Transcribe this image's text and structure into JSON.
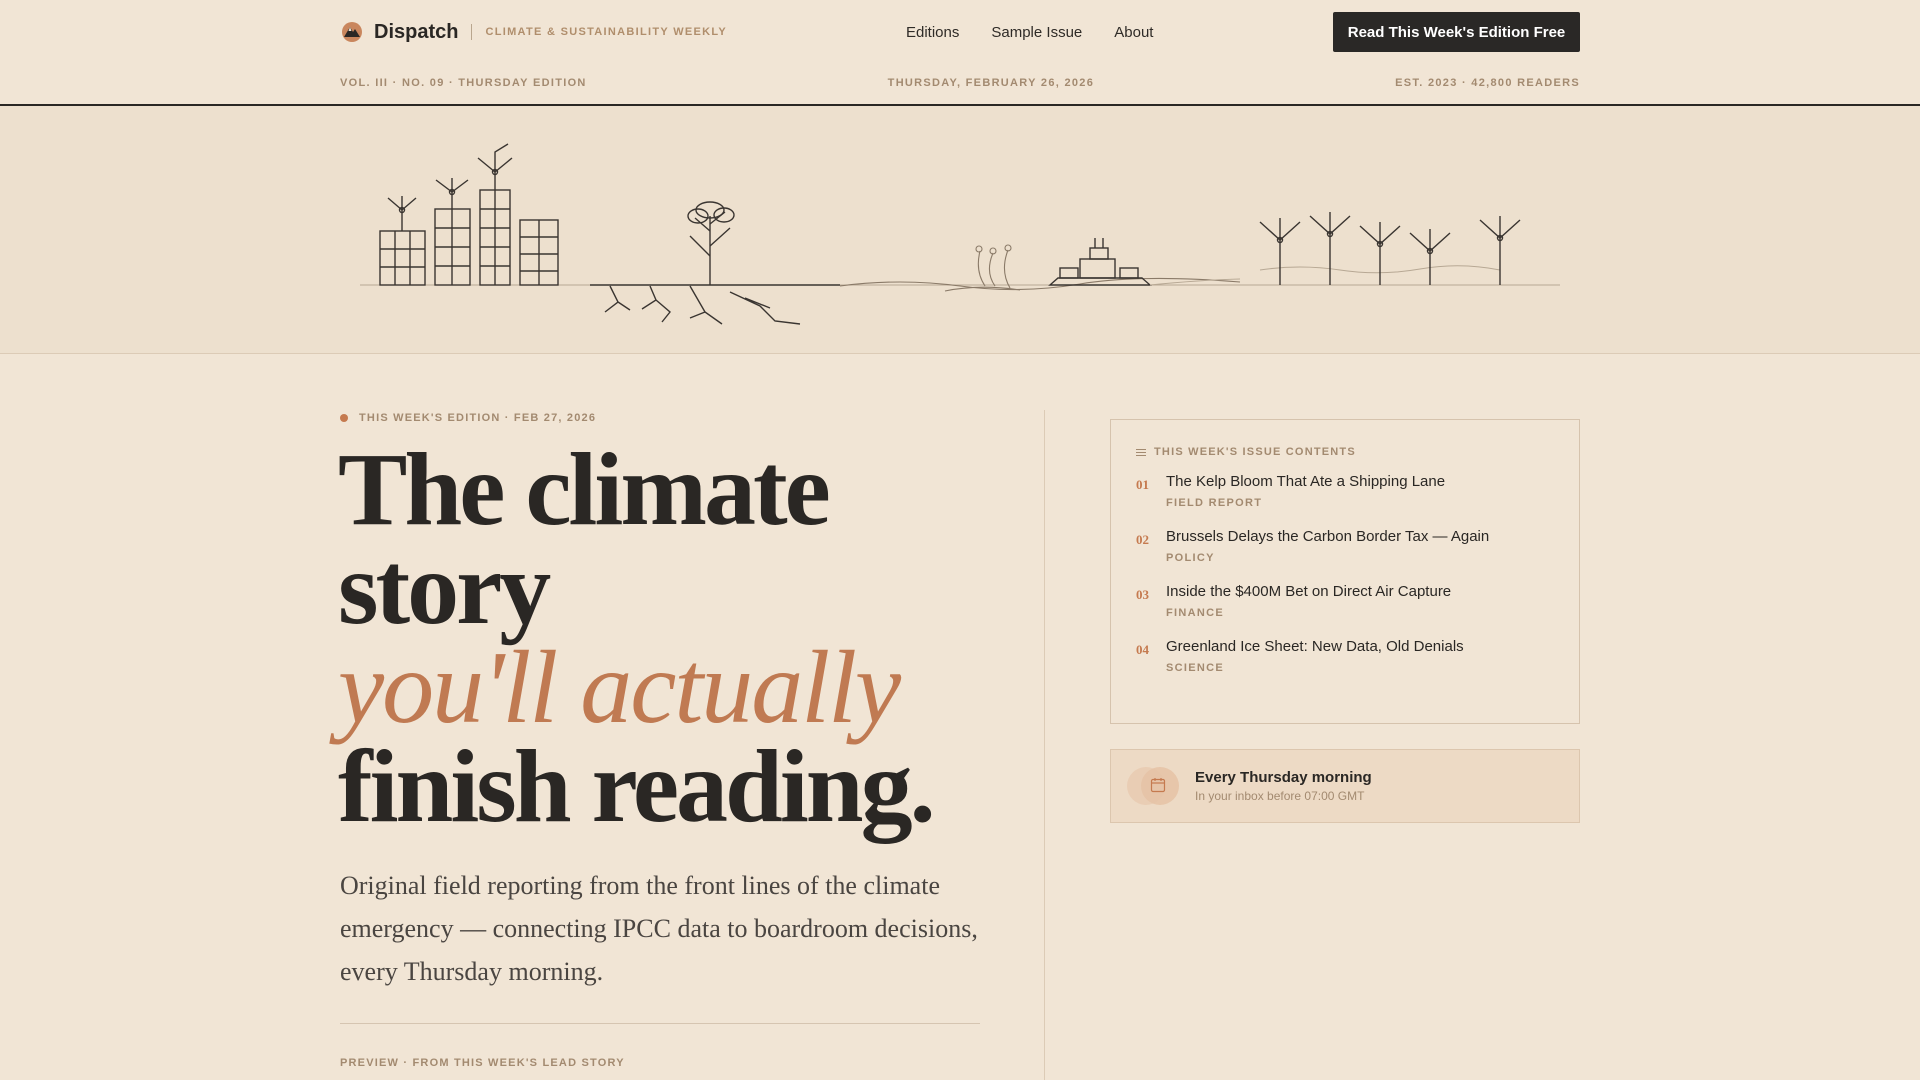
{
  "brand": {
    "name": "Dispatch",
    "tagline": "CLIMATE & SUSTAINABILITY WEEKLY"
  },
  "nav": {
    "links": [
      "Editions",
      "Sample Issue",
      "About"
    ],
    "cta": "Read This Week's Edition Free"
  },
  "masthead": {
    "left": "VOL. III · NO. 09 · THURSDAY EDITION",
    "center": "THURSDAY, FEBRUARY 26, 2026",
    "right": "EST. 2023 · 42,800 READERS"
  },
  "hero": {
    "eyebrow": "THIS WEEK'S EDITION · FEB 27, 2026",
    "headline_line1": "The climate",
    "headline_line2": "story",
    "headline_accent": "you'll actually",
    "headline_line4": "finish reading.",
    "lede": "Original field reporting from the front lines of the climate emergency — connecting IPCC data to boardroom decisions, every Thursday morning.",
    "preview_label": "PREVIEW · FROM THIS WEEK'S LEAD STORY"
  },
  "contents": {
    "title": "THIS WEEK'S ISSUE CONTENTS",
    "items": [
      {
        "num": "01",
        "title": "The Kelp Bloom That Ate a Shipping Lane",
        "category": "FIELD REPORT"
      },
      {
        "num": "02",
        "title": "Brussels Delays the Carbon Border Tax — Again",
        "category": "POLICY"
      },
      {
        "num": "03",
        "title": "Inside the $400M Bet on Direct Air Capture",
        "category": "FINANCE"
      },
      {
        "num": "04",
        "title": "Greenland Ice Sheet: New Data, Old Denials",
        "category": "SCIENCE"
      }
    ]
  },
  "schedule": {
    "title": "Every Thursday morning",
    "subtitle": "In your inbox before 07:00 GMT",
    "icon": "calendar-icon"
  },
  "colors": {
    "background": "#f1e5d5",
    "accent": "#c07a52",
    "ink": "#2a2724",
    "muted": "#a38a70"
  }
}
